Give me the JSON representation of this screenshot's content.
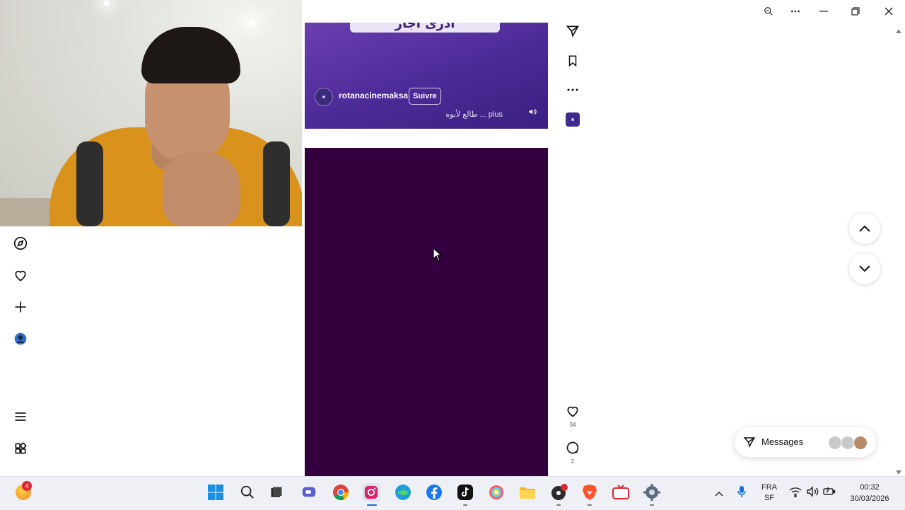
{
  "post1": {
    "banner_text": "أدرى أجار",
    "username": "rotanacinemaksa",
    "follow_label": "Suivre",
    "caption": "طالع لأبوه ... plus"
  },
  "post2": {
    "likes": "34",
    "comments": "2"
  },
  "messages": {
    "label": "Messages"
  },
  "taskbar": {
    "notification_badge": "4",
    "language_line1": "FRA",
    "language_line2": "SF",
    "time": "00:32",
    "date": "30/03/2026"
  },
  "colors": {
    "post2_bg": "#34003d",
    "post1_bg": "#4b2a96",
    "badge": "#e0262f"
  }
}
